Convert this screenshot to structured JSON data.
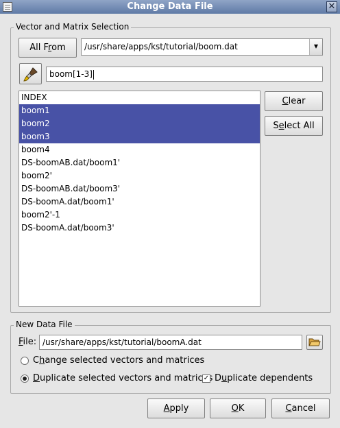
{
  "window": {
    "title": "Change Data File",
    "close_glyph": "✕"
  },
  "selection": {
    "legend": "Vector and Matrix Selection",
    "all_from_label": "All From",
    "all_from_mnemonic": "r",
    "source_file": "/usr/share/apps/kst/tutorial/boom.dat",
    "dropdown_glyph": "▾",
    "filter_value": "boom[1-3]",
    "items": [
      {
        "label": "INDEX",
        "selected": false
      },
      {
        "label": "boom1",
        "selected": true
      },
      {
        "label": "boom2",
        "selected": true
      },
      {
        "label": "boom3",
        "selected": true
      },
      {
        "label": "boom4",
        "selected": false
      },
      {
        "label": "DS-boomAB.dat/boom1'",
        "selected": false
      },
      {
        "label": "boom2'",
        "selected": false
      },
      {
        "label": "DS-boomAB.dat/boom3'",
        "selected": false
      },
      {
        "label": "DS-boomA.dat/boom1'",
        "selected": false
      },
      {
        "label": "boom2'-1",
        "selected": false
      },
      {
        "label": "DS-boomA.dat/boom3'",
        "selected": false
      }
    ],
    "clear_label": "Clear",
    "select_all_label": "Select All"
  },
  "new_file": {
    "legend": "New Data File",
    "file_label": "File:",
    "file_value": "/usr/share/apps/kst/tutorial/boomA.dat",
    "change_option": "Change selected vectors and matrices",
    "duplicate_option": "Duplicate selected vectors and matrices",
    "selected_option": "duplicate",
    "dup_dependents_label": "Duplicate dependents",
    "dup_dependents_checked": true,
    "check_glyph": "✓"
  },
  "actions": {
    "apply": "Apply",
    "ok": "OK",
    "cancel": "Cancel"
  },
  "colors": {
    "selection": "#4852a6",
    "titlebar": "#6f88b3"
  }
}
